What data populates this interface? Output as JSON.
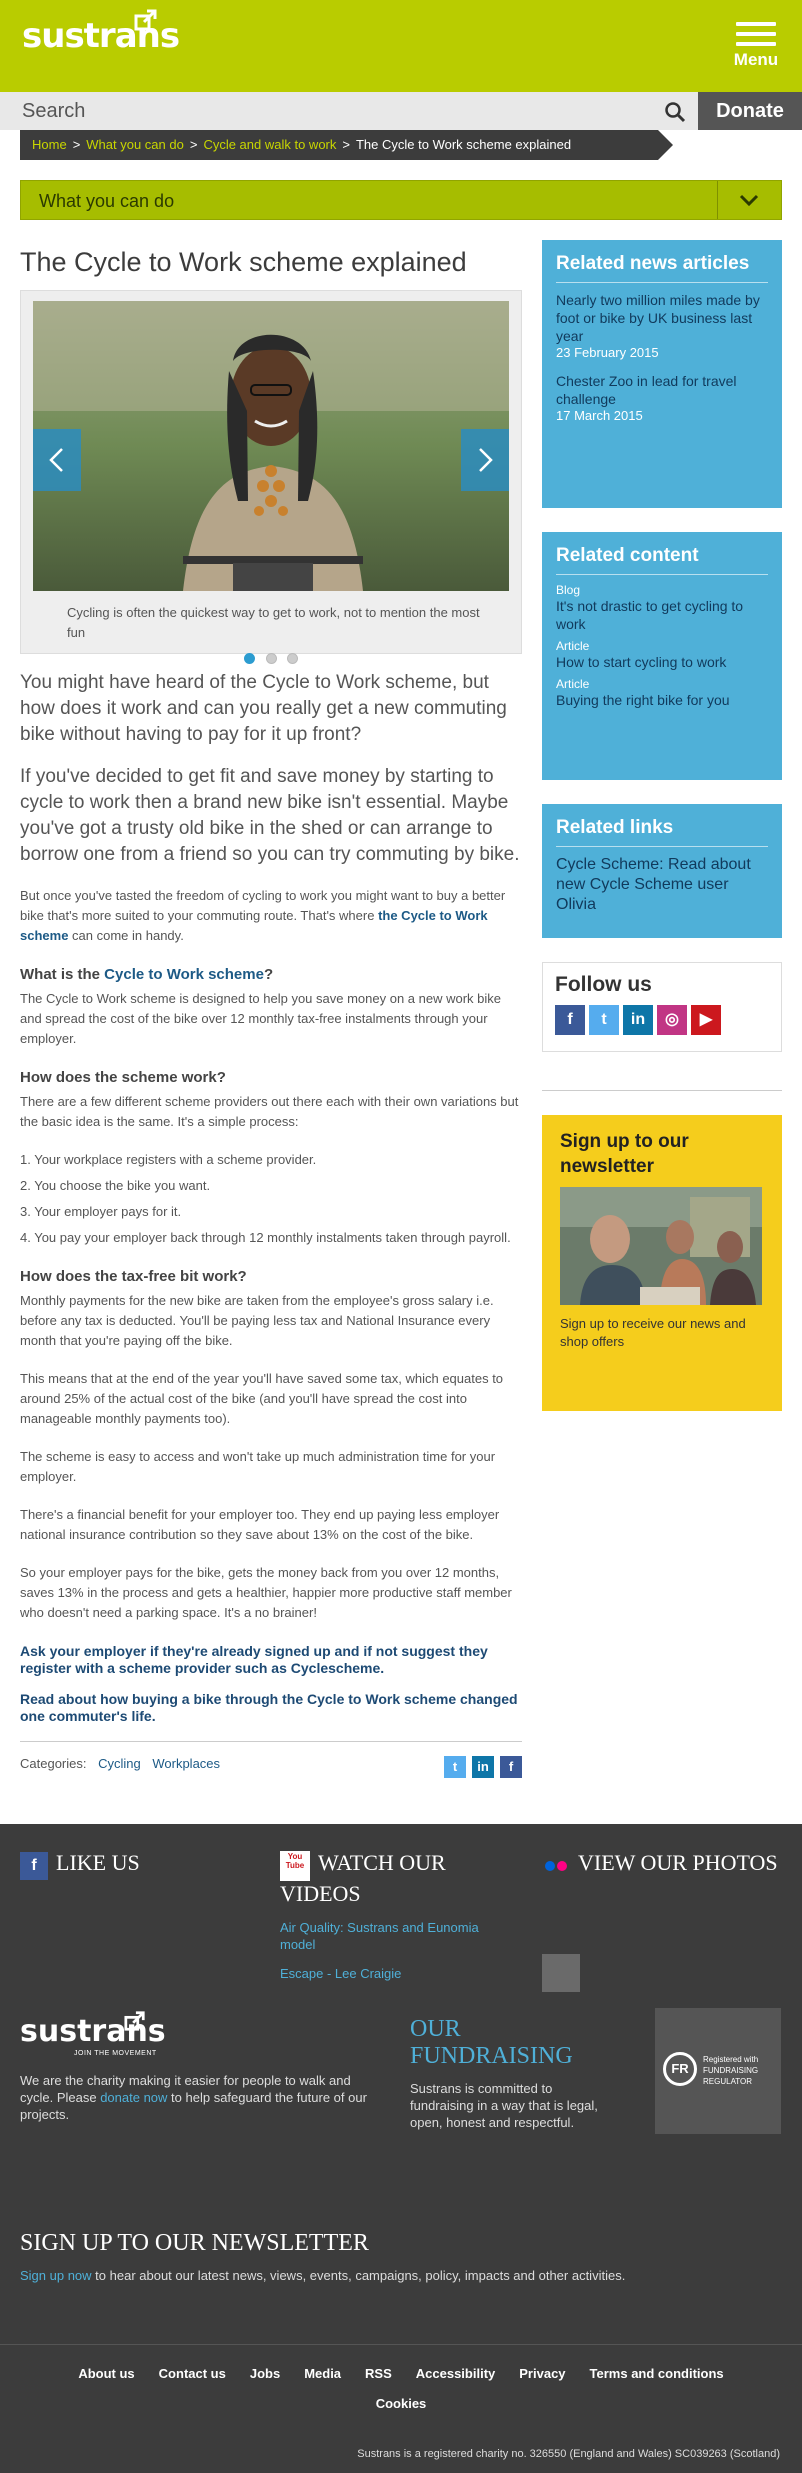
{
  "header": {
    "logo_text": "sustrans",
    "menu_label": "Menu",
    "search_placeholder": "Search",
    "donate_label": "Donate",
    "brand_color": "#b9cc00"
  },
  "breadcrumb": {
    "items": [
      "Home",
      "What you can do",
      "Cycle and walk to work"
    ],
    "current": "The Cycle to Work scheme explained"
  },
  "section_dropdown": {
    "label": "What you can do"
  },
  "article": {
    "title": "The Cycle to Work scheme explained",
    "slider_caption": "Cycling is often the quickest way to get to work, not to mention the most fun",
    "intro_1": "You might have heard of the Cycle to Work scheme, but how does it work and can you really get a new commuting bike without having to pay for it up front?",
    "intro_2": "If you've decided to get fit and save money by starting to cycle to work then a brand new bike isn't essential. Maybe you've got a trusty old bike in the shed or can arrange to borrow one from a friend so you can try commuting by bike.",
    "p_once_a": "But once you've tasted the freedom of cycling to work you might want to buy a better bike that's more suited to your commuting route. That's where ",
    "p_once_link": "the Cycle to Work scheme",
    "p_once_b": " can come in handy.",
    "h_what_a": "What is the ",
    "h_what_link": "Cycle to Work scheme",
    "h_what_b": "?",
    "p_what": "The Cycle to Work scheme is designed to help you save money on a new work bike and spread the cost of the bike over 12 monthly tax-free instalments through your employer.",
    "h_how": "How does the scheme work?",
    "p_how": "There are a few different scheme providers out there each with their own variations but the basic idea is the same. It's a simple process:",
    "steps": [
      "1. Your workplace registers with a scheme provider.",
      "2. You choose the bike you want.",
      "3. Your employer pays for it.",
      "4. You pay your employer back through 12 monthly instalments taken through payroll."
    ],
    "h_tax": "How does the tax-free bit work?",
    "p_tax_1": "Monthly payments for the new bike are taken from the employee's gross salary i.e. before any tax is deducted. You'll be paying less tax and National Insurance every month that you're paying off the bike.",
    "p_tax_2": "This means that at the end of the year you'll have saved some tax, which equates to around 25% of the actual cost of the bike (and you'll have spread the cost into manageable monthly payments too).",
    "p_tax_3": "The scheme is easy to access and won't take up much administration time for your employer.",
    "p_tax_4": "There's a financial benefit for your employer too. They end up paying less employer national insurance contribution so they save about 13% on the cost of the bike.",
    "p_tax_5": "So your employer pays for the bike, gets the money back from you over 12 months, saves 13% in the process and gets a healthier, happier more productive staff member who doesn't need a parking space. It's a no brainer!",
    "cta_1": "Ask your employer if they're already signed up and if not suggest they register with a scheme provider such as Cyclescheme.",
    "cta_2": "Read about how buying a bike through the Cycle to Work scheme changed one commuter's life.",
    "categories_label": "Categories:",
    "categories": [
      "Cycling",
      "Workplaces"
    ],
    "share_icons": [
      "twitter-icon",
      "linkedin-icon",
      "facebook-icon"
    ]
  },
  "sidebar": {
    "news_title": "Related news articles",
    "news": [
      {
        "title": "Nearly two million miles made by foot or bike by UK business last year",
        "date": "23 February 2015"
      },
      {
        "title": "Chester Zoo in lead for travel challenge",
        "date": "17 March 2015"
      }
    ],
    "content_title": "Related content",
    "content": [
      {
        "kind": "Blog",
        "title": "It's not drastic to get cycling to work"
      },
      {
        "kind": "Article",
        "title": "How to start cycling to work"
      },
      {
        "kind": "Article",
        "title": "Buying the right bike for you"
      }
    ],
    "links_title": "Related links",
    "links": [
      "Cycle Scheme: Read about new Cycle Scheme user Olivia"
    ],
    "follow_title": "Follow us",
    "follow_icons": [
      "facebook-icon",
      "twitter-icon",
      "linkedin-icon",
      "instagram-icon",
      "youtube-icon"
    ],
    "signup_title": "Sign up to our newsletter",
    "signup_text": "Sign up to receive our news and shop offers"
  },
  "footer": {
    "like_us": "LIKE US",
    "watch_videos": "WATCH OUR VIDEOS",
    "youtube_badge": "You Tube",
    "videos": [
      "Air Quality: Sustrans and Eunomia model",
      "Escape - Lee Craigie"
    ],
    "view_photos": "VIEW OUR PHOTOS",
    "logo_text": "sustrans",
    "logo_tagline": "JOIN THE MOVEMENT",
    "about_a": "We are the charity making it easier for people to walk and cycle. Please ",
    "about_link": "donate now",
    "about_b": " to help safeguard the future of our projects.",
    "fund_title": "OUR FUNDRAISING",
    "fund_text": "Sustrans is committed to fundraising in a way that is legal, open, honest and respectful.",
    "regulator_badge": "FR",
    "regulator_text": "Registered with FUNDRAISING REGULATOR",
    "newsletter_title": "SIGN UP TO OUR NEWSLETTER",
    "newsletter_link": "Sign up now",
    "newsletter_text": " to hear about our latest news, views, events, campaigns, policy, impacts and other activities.",
    "links": [
      "About us",
      "Contact us",
      "Jobs",
      "Media",
      "RSS",
      "Accessibility",
      "Privacy",
      "Terms and conditions"
    ],
    "cookies": "Cookies",
    "charity": "Sustrans is a registered charity no. 326550 (England and Wales) SC039263 (Scotland)"
  }
}
